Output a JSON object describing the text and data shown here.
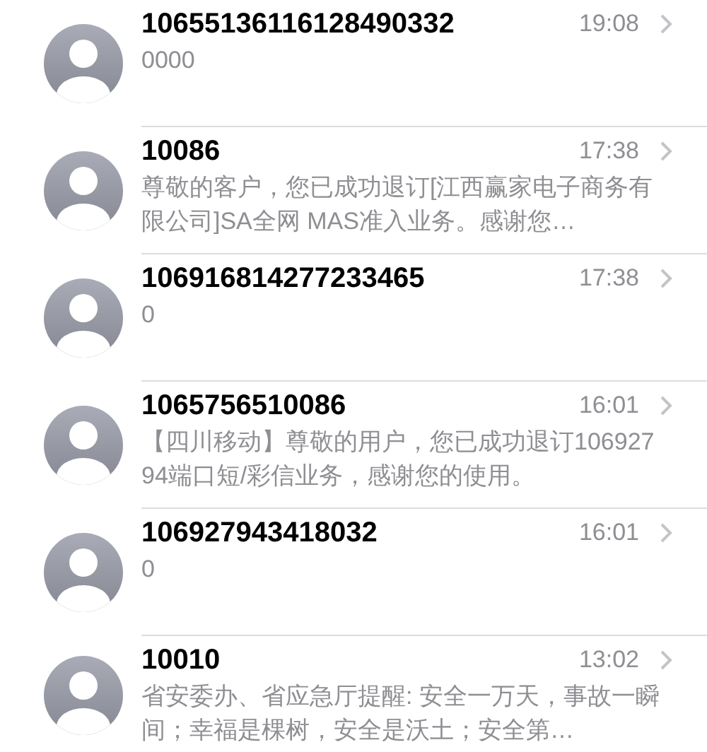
{
  "conversations": [
    {
      "sender": "10655136116128490332",
      "time": "19:08",
      "preview": "0000"
    },
    {
      "sender": "10086",
      "time": "17:38",
      "preview": "尊敬的客户，您已成功退订[江西赢家电子商务有限公司]SA全网 MAS准入业务。感谢您…"
    },
    {
      "sender": "106916814277233465",
      "time": "17:38",
      "preview": "0"
    },
    {
      "sender": "1065756510086",
      "time": "16:01",
      "preview": "【四川移动】尊敬的用户，您已成功退订10692794端口短/彩信业务，感谢您的使用。"
    },
    {
      "sender": "106927943418032",
      "time": "16:01",
      "preview": "0"
    },
    {
      "sender": "10010",
      "time": "13:02",
      "preview": "省安委办、省应急厅提醒: 安全一万天，事故一瞬间；幸福是棵树，安全是沃土；安全第…"
    }
  ]
}
